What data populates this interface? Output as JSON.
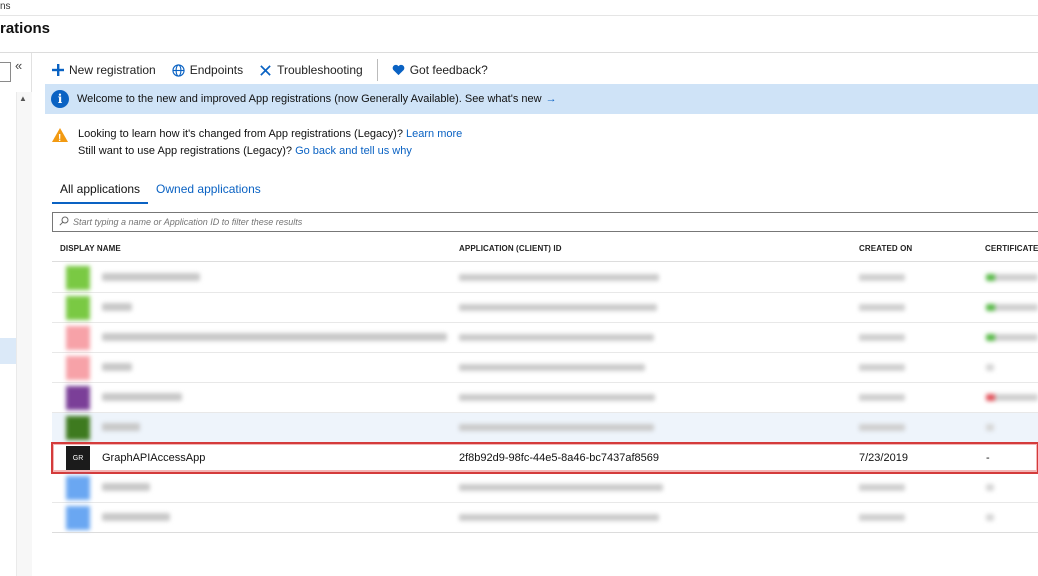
{
  "breadcrumb": "ns",
  "page_title": "rations",
  "left": {
    "collapse_glyph": "«",
    "scroll_up_glyph": "▲"
  },
  "toolbar": {
    "new_registration": "New registration",
    "endpoints": "Endpoints",
    "troubleshooting": "Troubleshooting",
    "feedback": "Got feedback?"
  },
  "banner": {
    "text": "Welcome to the new and improved App registrations (now Generally Available). See what's new",
    "arrow": "→"
  },
  "warning": {
    "line1": "Looking to learn how it's changed from App registrations (Legacy)?",
    "link1": "Learn more",
    "line2": "Still want to use App registrations (Legacy)?",
    "link2": "Go back and tell us why"
  },
  "tabs": {
    "all": "All applications",
    "owned": "Owned applications"
  },
  "filter": {
    "placeholder": "Start typing a name or Application ID to filter these results"
  },
  "table": {
    "headers": {
      "display_name": "DISPLAY NAME",
      "app_id": "APPLICATION (CLIENT) ID",
      "created_on": "CREATED ON",
      "certificates": "CERTIFICATES"
    },
    "selected_row": {
      "initials": "GR",
      "name": "GraphAPIAccessApp",
      "app_id": "2f8b92d9-98fc-44e5-8a46-bc7437af8569",
      "created_on": "7/23/2019",
      "certificates": "-"
    }
  },
  "colors": {
    "accent": "#0a62c3",
    "banner_bg": "#cfe3f7",
    "warning": "#f29a12",
    "selection_border": "#d43b3b",
    "avatar_green": "#7ac943",
    "avatar_pink": "#f7a2a8",
    "avatar_purple": "#7b3f98",
    "avatar_darkgreen": "#3e7a1f",
    "avatar_blue": "#6aa7f2",
    "cert_green": "#58b947",
    "cert_red": "#e2545c"
  }
}
